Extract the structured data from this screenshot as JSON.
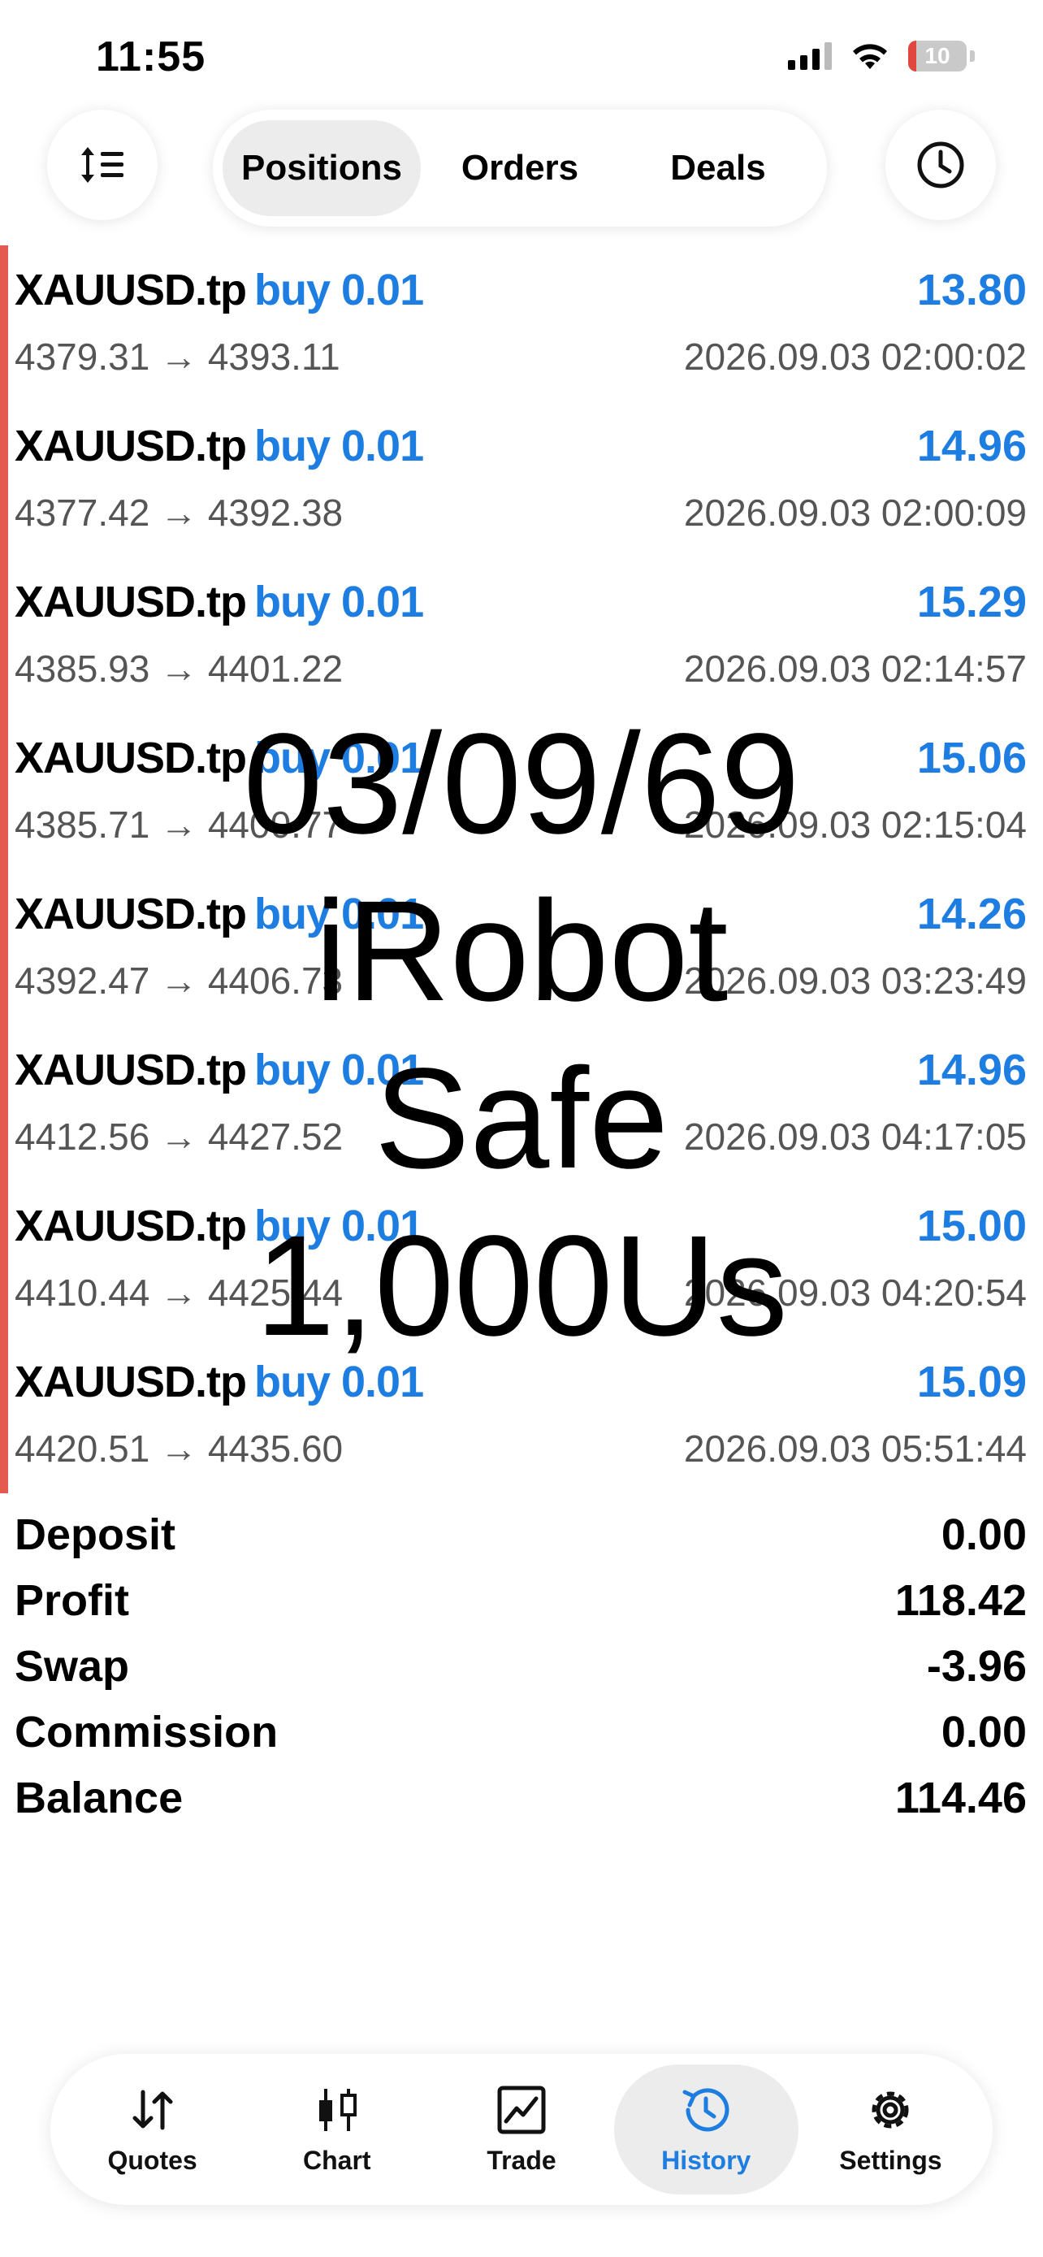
{
  "status_bar": {
    "time": "11:55",
    "battery": "10",
    "battery_level": 0.1
  },
  "tabs": [
    {
      "label": "Positions",
      "active": true
    },
    {
      "label": "Orders",
      "active": false
    },
    {
      "label": "Deals",
      "active": false
    }
  ],
  "icons": {
    "left": "sort-icon",
    "right": "clock-icon"
  },
  "deals": [
    {
      "symbol": "XAUUSD.tp",
      "side": "buy 0.01",
      "profit": "13.80",
      "prices": "4379.31 → 4393.11",
      "time": "2026.09.03 02:00:02"
    },
    {
      "symbol": "XAUUSD.tp",
      "side": "buy 0.01",
      "profit": "14.96",
      "prices": "4377.42 → 4392.38",
      "time": "2026.09.03 02:00:09"
    },
    {
      "symbol": "XAUUSD.tp",
      "side": "buy 0.01",
      "profit": "15.29",
      "prices": "4385.93 → 4401.22",
      "time": "2026.09.03 02:14:57"
    },
    {
      "symbol": "XAUUSD.tp",
      "side": "buy 0.01",
      "profit": "15.06",
      "prices": "4385.71 → 4400.77",
      "time": "2026.09.03 02:15:04"
    },
    {
      "symbol": "XAUUSD.tp",
      "side": "buy 0.01",
      "profit": "14.26",
      "prices": "4392.47 → 4406.73",
      "time": "2026.09.03 03:23:49"
    },
    {
      "symbol": "XAUUSD.tp",
      "side": "buy 0.01",
      "profit": "14.96",
      "prices": "4412.56 → 4427.52",
      "time": "2026.09.03 04:17:05"
    },
    {
      "symbol": "XAUUSD.tp",
      "side": "buy 0.01",
      "profit": "15.00",
      "prices": "4410.44 → 4425.44",
      "time": "2026.09.03 04:20:54"
    },
    {
      "symbol": "XAUUSD.tp",
      "side": "buy 0.01",
      "profit": "15.09",
      "prices": "4420.51 → 4435.60",
      "time": "2026.09.03 05:51:44"
    }
  ],
  "summary": [
    {
      "label": "Deposit",
      "value": "0.00"
    },
    {
      "label": "Profit",
      "value": "118.42"
    },
    {
      "label": "Swap",
      "value": "-3.96"
    },
    {
      "label": "Commission",
      "value": "0.00"
    },
    {
      "label": "Balance",
      "value": "114.46"
    }
  ],
  "overlay_lines": [
    "03/09/69",
    "iRobot",
    "Safe",
    "1,000Us"
  ],
  "nav": [
    {
      "label": "Quotes",
      "icon": "quotes-icon",
      "active": false
    },
    {
      "label": "Chart",
      "icon": "chart-icon",
      "active": false
    },
    {
      "label": "Trade",
      "icon": "trade-icon",
      "active": false
    },
    {
      "label": "History",
      "icon": "history-icon",
      "active": true
    },
    {
      "label": "Settings",
      "icon": "settings-icon",
      "active": false
    }
  ],
  "colors": {
    "accent": "#1e7de0",
    "loss_bar": "#e45a4f",
    "muted": "#555555"
  }
}
